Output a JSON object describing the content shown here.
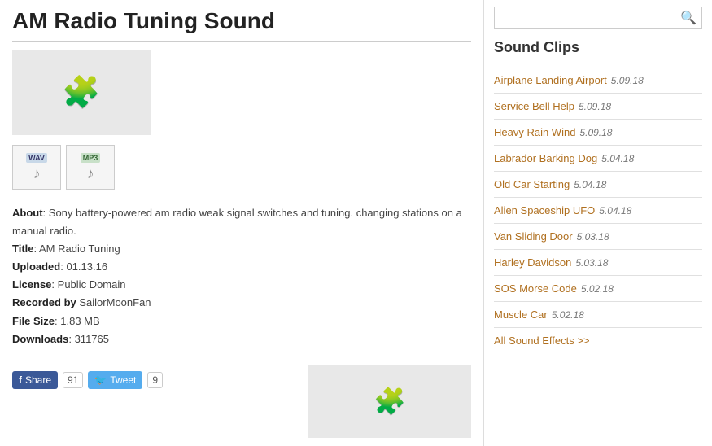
{
  "page": {
    "title": "AM Radio Tuning Sound"
  },
  "meta": {
    "about_label": "About",
    "about_text": ": Sony battery-powered am radio weak signal switches and tuning. changing stations on a manual radio.",
    "title_label": "Title",
    "title_value": "AM Radio Tuning",
    "uploaded_label": "Uploaded",
    "uploaded_value": "01.13.16",
    "license_label": "License",
    "license_value": "Public Domain",
    "recorded_label": "Recorded by",
    "recorded_value": "SailorMoonFan",
    "filesize_label": "File Size",
    "filesize_value": "1.83 MB",
    "downloads_label": "Downloads",
    "downloads_value": "311765"
  },
  "files": [
    {
      "type": "WAV",
      "class": "wav"
    },
    {
      "type": "MP3",
      "class": "mp3"
    }
  ],
  "social": {
    "fb_label": "Share",
    "fb_count": "91",
    "tw_label": "Tweet",
    "tw_count": "9"
  },
  "sidebar": {
    "search_placeholder": "",
    "sound_clips_title": "Sound Clips",
    "clips": [
      {
        "name": "Airplane Landing Airport",
        "date": "5.09.18"
      },
      {
        "name": "Service Bell Help",
        "date": "5.09.18"
      },
      {
        "name": "Heavy Rain Wind",
        "date": "5.09.18"
      },
      {
        "name": "Labrador Barking Dog",
        "date": "5.04.18"
      },
      {
        "name": "Old Car Starting",
        "date": "5.04.18"
      },
      {
        "name": "Alien Spaceship UFO",
        "date": "5.04.18"
      },
      {
        "name": "Van Sliding Door",
        "date": "5.03.18"
      },
      {
        "name": "Harley Davidson",
        "date": "5.03.18"
      },
      {
        "name": "SOS Morse Code",
        "date": "5.02.18"
      },
      {
        "name": "Muscle Car",
        "date": "5.02.18"
      }
    ],
    "all_effects_text": "All Sound Effects >>"
  }
}
